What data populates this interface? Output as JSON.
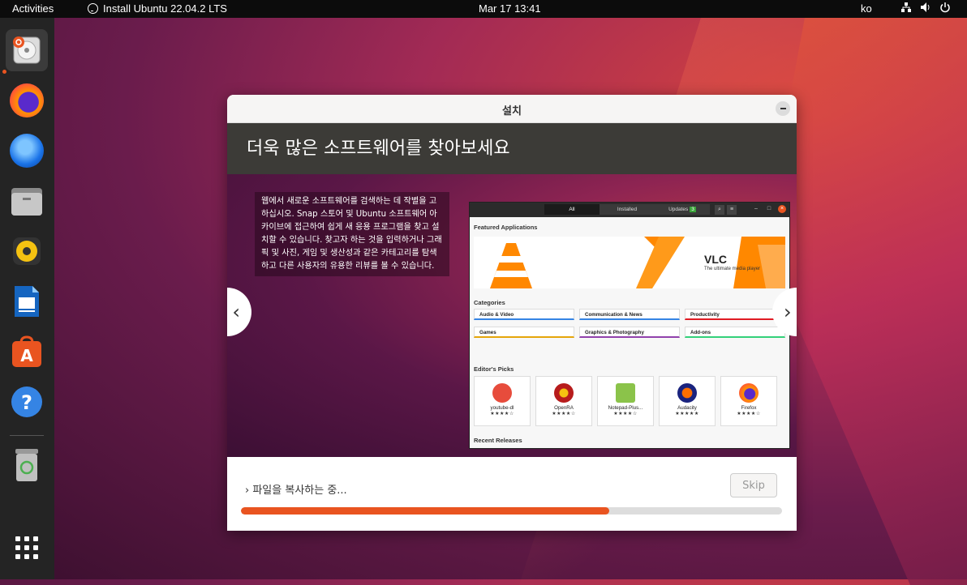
{
  "topbar": {
    "activities": "Activities",
    "app_name": "Install Ubuntu 22.04.2 LTS",
    "clock": "Mar 17  13:41",
    "lang": "ko",
    "tray_icons": [
      "network-icon",
      "volume-icon",
      "power-icon"
    ]
  },
  "dock": {
    "items": [
      "ubuntu-installer",
      "firefox",
      "thunderbird",
      "files",
      "rhythmbox",
      "libreoffice-writer",
      "ubuntu-software",
      "help",
      "trash",
      "show-apps"
    ]
  },
  "window": {
    "title": "설치",
    "slide_title": "더욱 많은 소프트웨어를 찾아보세요",
    "slide_text": "웹에서 새로운 소프트웨어를 검색하는 데 작별을 고하십시오. Snap 스토어 및 Ubuntu 소프트웨어 아카이브에 접근하여 쉽게 새 응용 프로그램을 찾고 설치할 수 있습니다. 찾고자 하는 것을 입력하거나 그래픽 및 사진, 게임 및 생산성과 같은 카테고리를 탐색하고 다른 사용자의 유용한 리뷰를 볼 수 있습니다.",
    "prev_glyph": "‹",
    "next_glyph": "›",
    "status_text": "파일을 복사하는 중...",
    "status_expander": "›",
    "skip_label": "Skip",
    "progress": 0.68
  },
  "store": {
    "tabs": {
      "all": "All",
      "installed": "Installed",
      "updates": "Updates",
      "updates_count": "3"
    },
    "featured": "Featured Applications",
    "banner_title": "VLC",
    "banner_subtitle": "The ultimate media player",
    "categories_title": "Categories",
    "categories": [
      "Audio & Video",
      "Communication & News",
      "Productivity",
      "Games",
      "Graphics & Photography",
      "Add-ons"
    ],
    "editors_picks": "Editor's Picks",
    "picks": [
      {
        "name": "youtube-dl",
        "stars": "★★★★☆"
      },
      {
        "name": "OpenRA",
        "stars": "★★★★☆"
      },
      {
        "name": "Notepad-Plus...",
        "stars": "★★★★☆"
      },
      {
        "name": "Audacity",
        "stars": "★★★★★"
      },
      {
        "name": "Firefox",
        "stars": "★★★★☆"
      }
    ],
    "recent": "Recent Releases"
  },
  "colors": {
    "accent": "#e95420",
    "dock_bg": "#242424",
    "header_bg": "#3c3b37"
  }
}
